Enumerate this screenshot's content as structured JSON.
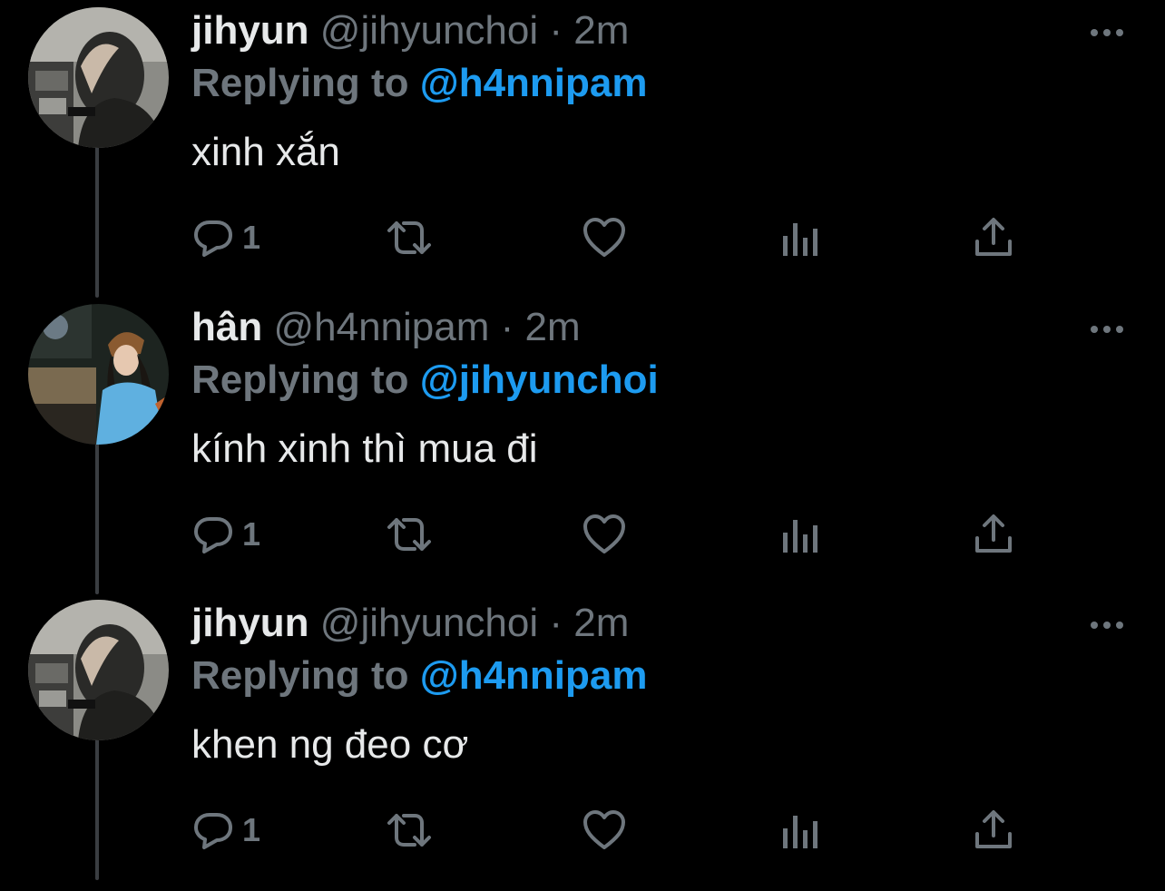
{
  "colors": {
    "background": "#000000",
    "text_primary": "#e7e9ea",
    "text_secondary": "#6e767d",
    "accent": "#1d9bf0",
    "thread_line": "#3a3d41"
  },
  "tweets": [
    {
      "display_name": "jihyun",
      "handle": "@jihyunchoi",
      "separator": "·",
      "time": "2m",
      "reply_prefix": "Replying to",
      "reply_to": "@h4nnipam",
      "text": "xinh xắn",
      "reply_count": "1",
      "avatar": "profile-photo-jihyun",
      "icons": [
        "reply-icon",
        "retweet-icon",
        "like-icon",
        "analytics-icon",
        "share-icon",
        "more-icon"
      ]
    },
    {
      "display_name": "hân",
      "handle": "@h4nnipam",
      "separator": "·",
      "time": "2m",
      "reply_prefix": "Replying to",
      "reply_to": "@jihyunchoi",
      "text": "kính xinh thì mua đi",
      "reply_count": "1",
      "avatar": "profile-photo-han",
      "icons": [
        "reply-icon",
        "retweet-icon",
        "like-icon",
        "analytics-icon",
        "share-icon",
        "more-icon"
      ]
    },
    {
      "display_name": "jihyun",
      "handle": "@jihyunchoi",
      "separator": "·",
      "time": "2m",
      "reply_prefix": "Replying to",
      "reply_to": "@h4nnipam",
      "text": "khen ng đeo cơ",
      "reply_count": "1",
      "avatar": "profile-photo-jihyun",
      "icons": [
        "reply-icon",
        "retweet-icon",
        "like-icon",
        "analytics-icon",
        "share-icon",
        "more-icon"
      ]
    }
  ]
}
